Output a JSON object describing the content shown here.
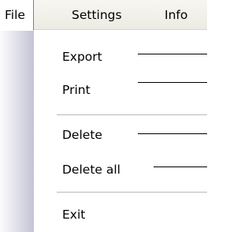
{
  "menubar": {
    "items": [
      {
        "label": "File",
        "active": true
      },
      {
        "label": "Settings",
        "active": false
      },
      {
        "label": "Info",
        "active": false
      }
    ]
  },
  "file_menu": {
    "items": [
      {
        "label": "Export"
      },
      {
        "label": "Print"
      },
      {
        "label": "Delete"
      },
      {
        "label": "Delete all"
      },
      {
        "label": "Exit"
      }
    ]
  },
  "colors": {
    "menubar_bg": "#f3f2ec",
    "gutter_dark": "#c4c3d6",
    "separator": "#b9b9b9"
  }
}
